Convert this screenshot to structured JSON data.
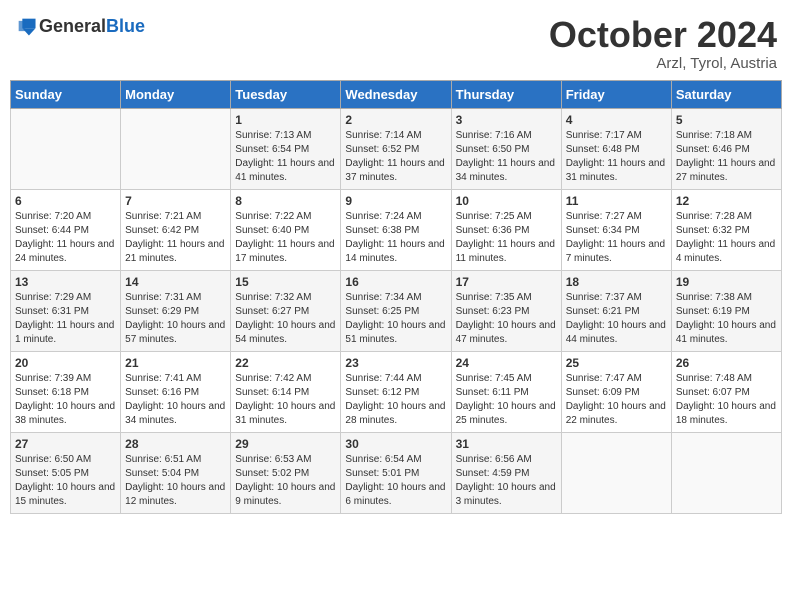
{
  "header": {
    "logo_general": "General",
    "logo_blue": "Blue",
    "month_title": "October 2024",
    "subtitle": "Arzl, Tyrol, Austria"
  },
  "days_of_week": [
    "Sunday",
    "Monday",
    "Tuesday",
    "Wednesday",
    "Thursday",
    "Friday",
    "Saturday"
  ],
  "weeks": [
    [
      {
        "day": "",
        "content": ""
      },
      {
        "day": "",
        "content": ""
      },
      {
        "day": "1",
        "content": "Sunrise: 7:13 AM\nSunset: 6:54 PM\nDaylight: 11 hours and 41 minutes."
      },
      {
        "day": "2",
        "content": "Sunrise: 7:14 AM\nSunset: 6:52 PM\nDaylight: 11 hours and 37 minutes."
      },
      {
        "day": "3",
        "content": "Sunrise: 7:16 AM\nSunset: 6:50 PM\nDaylight: 11 hours and 34 minutes."
      },
      {
        "day": "4",
        "content": "Sunrise: 7:17 AM\nSunset: 6:48 PM\nDaylight: 11 hours and 31 minutes."
      },
      {
        "day": "5",
        "content": "Sunrise: 7:18 AM\nSunset: 6:46 PM\nDaylight: 11 hours and 27 minutes."
      }
    ],
    [
      {
        "day": "6",
        "content": "Sunrise: 7:20 AM\nSunset: 6:44 PM\nDaylight: 11 hours and 24 minutes."
      },
      {
        "day": "7",
        "content": "Sunrise: 7:21 AM\nSunset: 6:42 PM\nDaylight: 11 hours and 21 minutes."
      },
      {
        "day": "8",
        "content": "Sunrise: 7:22 AM\nSunset: 6:40 PM\nDaylight: 11 hours and 17 minutes."
      },
      {
        "day": "9",
        "content": "Sunrise: 7:24 AM\nSunset: 6:38 PM\nDaylight: 11 hours and 14 minutes."
      },
      {
        "day": "10",
        "content": "Sunrise: 7:25 AM\nSunset: 6:36 PM\nDaylight: 11 hours and 11 minutes."
      },
      {
        "day": "11",
        "content": "Sunrise: 7:27 AM\nSunset: 6:34 PM\nDaylight: 11 hours and 7 minutes."
      },
      {
        "day": "12",
        "content": "Sunrise: 7:28 AM\nSunset: 6:32 PM\nDaylight: 11 hours and 4 minutes."
      }
    ],
    [
      {
        "day": "13",
        "content": "Sunrise: 7:29 AM\nSunset: 6:31 PM\nDaylight: 11 hours and 1 minute."
      },
      {
        "day": "14",
        "content": "Sunrise: 7:31 AM\nSunset: 6:29 PM\nDaylight: 10 hours and 57 minutes."
      },
      {
        "day": "15",
        "content": "Sunrise: 7:32 AM\nSunset: 6:27 PM\nDaylight: 10 hours and 54 minutes."
      },
      {
        "day": "16",
        "content": "Sunrise: 7:34 AM\nSunset: 6:25 PM\nDaylight: 10 hours and 51 minutes."
      },
      {
        "day": "17",
        "content": "Sunrise: 7:35 AM\nSunset: 6:23 PM\nDaylight: 10 hours and 47 minutes."
      },
      {
        "day": "18",
        "content": "Sunrise: 7:37 AM\nSunset: 6:21 PM\nDaylight: 10 hours and 44 minutes."
      },
      {
        "day": "19",
        "content": "Sunrise: 7:38 AM\nSunset: 6:19 PM\nDaylight: 10 hours and 41 minutes."
      }
    ],
    [
      {
        "day": "20",
        "content": "Sunrise: 7:39 AM\nSunset: 6:18 PM\nDaylight: 10 hours and 38 minutes."
      },
      {
        "day": "21",
        "content": "Sunrise: 7:41 AM\nSunset: 6:16 PM\nDaylight: 10 hours and 34 minutes."
      },
      {
        "day": "22",
        "content": "Sunrise: 7:42 AM\nSunset: 6:14 PM\nDaylight: 10 hours and 31 minutes."
      },
      {
        "day": "23",
        "content": "Sunrise: 7:44 AM\nSunset: 6:12 PM\nDaylight: 10 hours and 28 minutes."
      },
      {
        "day": "24",
        "content": "Sunrise: 7:45 AM\nSunset: 6:11 PM\nDaylight: 10 hours and 25 minutes."
      },
      {
        "day": "25",
        "content": "Sunrise: 7:47 AM\nSunset: 6:09 PM\nDaylight: 10 hours and 22 minutes."
      },
      {
        "day": "26",
        "content": "Sunrise: 7:48 AM\nSunset: 6:07 PM\nDaylight: 10 hours and 18 minutes."
      }
    ],
    [
      {
        "day": "27",
        "content": "Sunrise: 6:50 AM\nSunset: 5:05 PM\nDaylight: 10 hours and 15 minutes."
      },
      {
        "day": "28",
        "content": "Sunrise: 6:51 AM\nSunset: 5:04 PM\nDaylight: 10 hours and 12 minutes."
      },
      {
        "day": "29",
        "content": "Sunrise: 6:53 AM\nSunset: 5:02 PM\nDaylight: 10 hours and 9 minutes."
      },
      {
        "day": "30",
        "content": "Sunrise: 6:54 AM\nSunset: 5:01 PM\nDaylight: 10 hours and 6 minutes."
      },
      {
        "day": "31",
        "content": "Sunrise: 6:56 AM\nSunset: 4:59 PM\nDaylight: 10 hours and 3 minutes."
      },
      {
        "day": "",
        "content": ""
      },
      {
        "day": "",
        "content": ""
      }
    ]
  ]
}
